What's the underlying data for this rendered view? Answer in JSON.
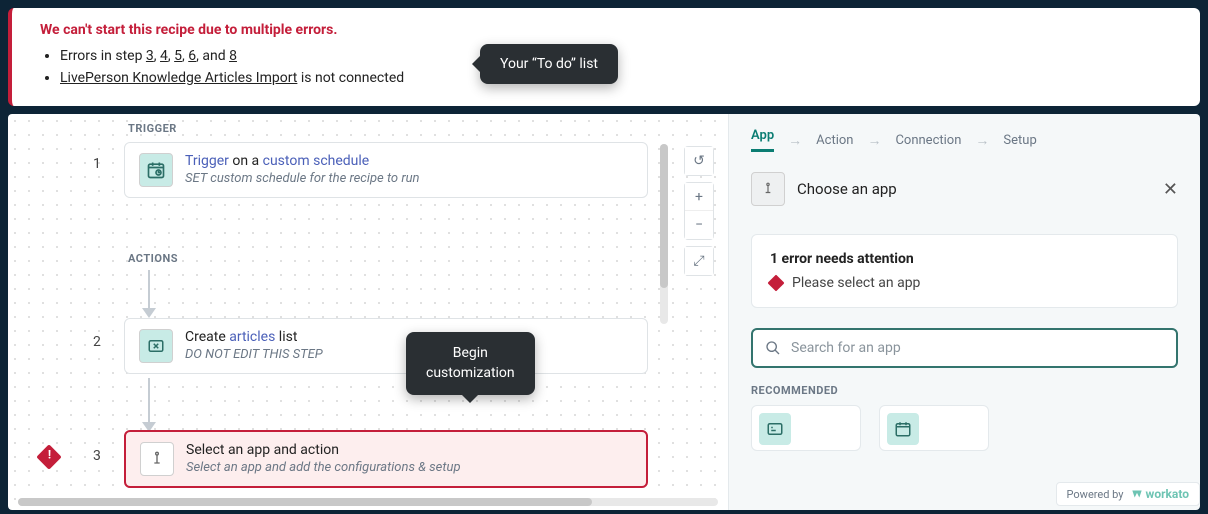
{
  "callouts": {
    "todo": "Your “To do” list",
    "begin_line1": "Begin",
    "begin_line2": "customization"
  },
  "error_banner": {
    "title": "We can't start this recipe due to multiple errors.",
    "line1_prefix": "Errors in step ",
    "steps": [
      "3",
      "4",
      "5",
      "6"
    ],
    "line1_and": ", and ",
    "last_step": "8",
    "line2_link": "LivePerson Knowledge Articles Import",
    "line2_suffix": " is not connected"
  },
  "canvas": {
    "section_trigger": "TRIGGER",
    "section_actions": "ACTIONS",
    "steps": [
      {
        "num": "1",
        "title_pre": "Trigger",
        "title_mid": " on a ",
        "title_link": "custom schedule",
        "sub": "SET custom schedule for the recipe to run"
      },
      {
        "num": "2",
        "title_pre": "Create ",
        "title_link": "articles",
        "title_post": " list",
        "sub": "DO NOT EDIT THIS STEP"
      },
      {
        "num": "3",
        "title": "Select an app and action",
        "sub": "Select an app and  add the configurations & setup"
      }
    ],
    "controls": {
      "undo": "↺",
      "zoom_in": "+",
      "zoom_out": "−",
      "fit": "⤢"
    }
  },
  "right": {
    "tabs": [
      "App",
      "Action",
      "Connection",
      "Setup"
    ],
    "choose_label": "Choose an app",
    "attention_title": "1 error needs attention",
    "attention_msg": "Please select an app",
    "search_placeholder": "Search for an app",
    "recommended_label": "RECOMMENDED"
  },
  "powered": {
    "prefix": "Powered by",
    "brand": "workato"
  }
}
